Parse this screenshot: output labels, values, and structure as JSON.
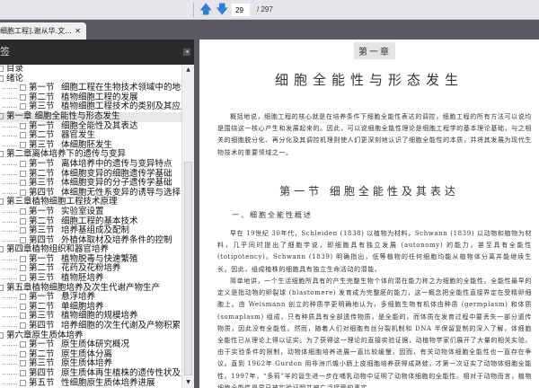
{
  "toolbar": {
    "prev_icon": "arrow-up-icon",
    "next_icon": "arrow-down-icon",
    "page": "29",
    "total": "/ 297"
  },
  "tab": {
    "label": "细胞工程].谢从华.文...",
    "close": "✕"
  },
  "panel": {
    "title": "签",
    "collapse": "◂"
  },
  "tree": [
    {
      "lvl": 0,
      "label": "目录"
    },
    {
      "lvl": 0,
      "label": "绪论"
    },
    {
      "lvl": 1,
      "sec": "第一节",
      "label": "细胞工程在生物技术领域中的地位"
    },
    {
      "lvl": 1,
      "sec": "第二节",
      "label": "植物细胞工程的发展"
    },
    {
      "lvl": 1,
      "sec": "第三节",
      "label": "植物细胞工程技术的类别及其应用"
    },
    {
      "lvl": 0,
      "label": "第一章  细胞全能性与形态发生",
      "sel": true
    },
    {
      "lvl": 1,
      "sec": "第一节",
      "label": "细胞全能性及其表达"
    },
    {
      "lvl": 1,
      "sec": "第二节",
      "label": "器官发生"
    },
    {
      "lvl": 1,
      "sec": "第三节",
      "label": "体细胞胚发生"
    },
    {
      "lvl": 0,
      "label": "第二章离体培养下的遗传与变异"
    },
    {
      "lvl": 1,
      "sec": "第一节",
      "label": "离体培养中的遗传与变异特点"
    },
    {
      "lvl": 1,
      "sec": "第二节",
      "label": "体细胞变异的细胞遗传学基础"
    },
    {
      "lvl": 1,
      "sec": "第三节",
      "label": "体细胞变异的分子遗传学基础"
    },
    {
      "lvl": 1,
      "sec": "第四节",
      "label": "体细胞无性系变异的诱导与选择"
    },
    {
      "lvl": 0,
      "label": "第三章植物细胞工程技术原理"
    },
    {
      "lvl": 1,
      "sec": "第一节",
      "label": "实验室设置"
    },
    {
      "lvl": 1,
      "sec": "第二节",
      "label": "细胞工程的基本技术"
    },
    {
      "lvl": 1,
      "sec": "第三节",
      "label": "培养基组成及配制"
    },
    {
      "lvl": 1,
      "sec": "第四节",
      "label": "外植体取材及培养条件的控制"
    },
    {
      "lvl": 0,
      "label": "第四章植物组织和器官培养"
    },
    {
      "lvl": 1,
      "sec": "第一节",
      "label": "植物脱毒与快速繁殖"
    },
    {
      "lvl": 1,
      "sec": "第二节",
      "label": "花药及花粉培养"
    },
    {
      "lvl": 1,
      "sec": "第三节",
      "label": "植物胚培养"
    },
    {
      "lvl": 0,
      "label": "第五章植物细胞培养及次生代谢产物生产"
    },
    {
      "lvl": 1,
      "sec": "第一节",
      "label": "悬浮培养"
    },
    {
      "lvl": 1,
      "sec": "第二节",
      "label": "单细胞培养"
    },
    {
      "lvl": 1,
      "sec": "第三节",
      "label": "植物细胞的规模培养"
    },
    {
      "lvl": 1,
      "sec": "第四节",
      "label": "培养细胞的次生代谢及产物积累"
    },
    {
      "lvl": 0,
      "label": "第六章原生质体培养"
    },
    {
      "lvl": 1,
      "sec": "第一节",
      "label": "原生质体研究概况"
    },
    {
      "lvl": 1,
      "sec": "第二节",
      "label": "原生质体分离"
    },
    {
      "lvl": 1,
      "sec": "第三节",
      "label": "原生质体培养"
    },
    {
      "lvl": 1,
      "sec": "第四节",
      "label": "原生质体再生植株的遗传性状及变异"
    },
    {
      "lvl": 1,
      "sec": "第五节",
      "label": "性细胞原生质体培养进展"
    }
  ],
  "doc": {
    "chapter": "第一章",
    "title": "细胞全能性与形态发生",
    "intro": "概括地说，细胞工程的核心就是在培养条件下细胞全能性表达的调控，细胞工程的所有方法可以说均是围绕这一核心产生和发展起来的。因此，可以说细胞全能性理论是细胞工程学的基本理论基础，与之相关的细胞脱分化、再分化及其调控机理则使人们更深刻地认识了细胞全能性的本质，并将其发展为现代生物技术的重要领域之一。",
    "section": "第一节  细胞全能性及其表达",
    "subsection": "一、细胞全能性概述",
    "p1": "早在 19世纪 30年代，Schleiden (1838) 以植物为材料，Schwann (1839) 以动物和植物为材料，几乎同时提出了细胞学说，即细胞具有独立发展 (autonomy) 的能力，甚至具有全能性 (totipotency)。Schwann (1839) 明确指出，低等植物的任何细胞均能从植物体分离并能继续生长。因此，组成植株的细胞具有独立生命活动的潜能。",
    "p2": "简单地讲，一个生活细胞所具有的产生完整生物个体的潜在能力称之为细胞的全能性。全能性最早的定义是指动物的卵裂球 (blastomere) 发育成为完整胚的能力，这一概念把全能性直接界定在受精卵细胞上。由 Weismann 创立的种质学更明确地认为，多细胞生物有机体由种质 (germplasm) 和体质 (somaplasm) 组成，只有种质具有全部遗传物质，是全能的，而体质在发育过程中要丢失一部分遗传物质，因此没有全能性。然而，随着人们对细胞有丝分裂机制和 DNA 半保留复制的深入了解，体细胞全能性已从理论上得以证实。为了获得这一理论的直接实验证据，动植物学家们展开了大量的相关实验。由于实验条件的限制，动物体细胞培养进展一直比较缓慢，因而，有关动物体细胞全能性也一直存在争议。直到 1962年 Gurdon 用非洲爪蟾小肠上皮细胞培养获得成熟蛙，才第一次证实了动物体细胞全能性。1997年，“多莉”羊的诞生进一步在哺乳动物中证明了动物体细胞的全能性。相对于动物而言，植物细胞全能性是早已被实验证明并被广泛接受的事实。"
  }
}
